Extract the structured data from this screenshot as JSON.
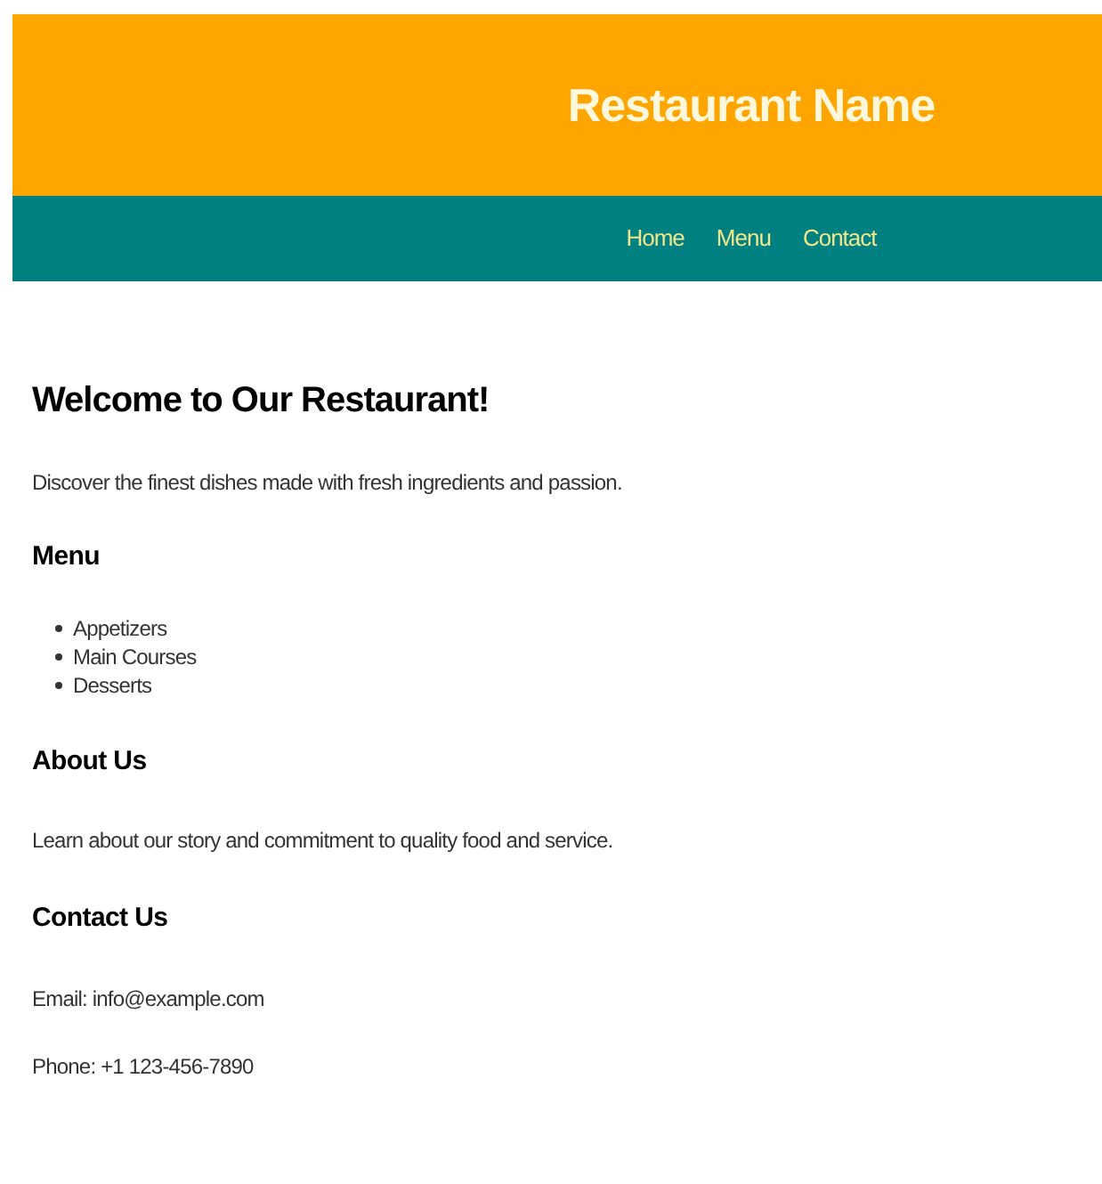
{
  "header": {
    "title": "Restaurant Name"
  },
  "nav": [
    {
      "label": "Home"
    },
    {
      "label": "Menu"
    },
    {
      "label": "Contact"
    }
  ],
  "welcome": {
    "heading": "Welcome to Our Restaurant!",
    "text": "Discover the finest dishes made with fresh ingredients and passion."
  },
  "menu": {
    "heading": "Menu",
    "items": [
      "Appetizers",
      "Main Courses",
      "Desserts"
    ]
  },
  "about": {
    "heading": "About Us",
    "text": "Learn about our story and commitment to quality food and service."
  },
  "contact": {
    "heading": "Contact Us",
    "lines": [
      "Email: info@example.com",
      "Phone: +1 123-456-7890"
    ]
  }
}
